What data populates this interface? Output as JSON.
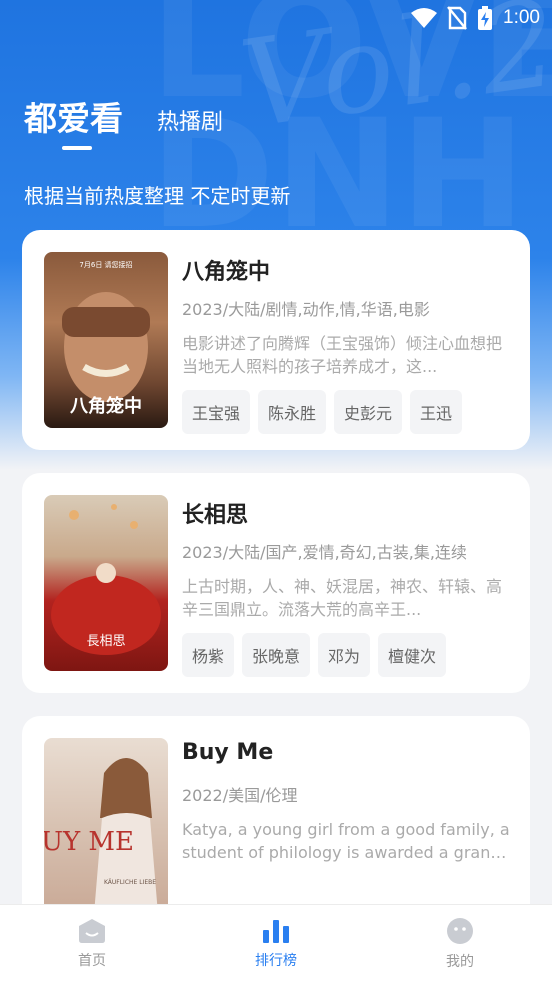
{
  "status": {
    "time": "1:00"
  },
  "header": {
    "tabs": [
      {
        "label": "都爱看"
      },
      {
        "label": "热播剧"
      }
    ],
    "subtitle": "根据当前热度整理 不定时更新"
  },
  "items": [
    {
      "title": "八角笼中",
      "meta": "2023/大陆/剧情,动作,情,华语,电影",
      "desc": "电影讲述了向腾辉（王宝强饰）倾注心血想把当地无人照料的孩子培养成才，这...",
      "tags": [
        "王宝强",
        "陈永胜",
        "史彭元",
        "王迅"
      ],
      "poster_text": "八角笼中",
      "poster_top_text": "7月6日 请您接招"
    },
    {
      "title": "长相思",
      "meta": "2023/大陆/国产,爱情,奇幻,古装,集,连续",
      "desc": "上古时期，人、神、妖混居，神农、轩辕、高辛三国鼎立。流落大荒的高辛王...",
      "tags": [
        "杨紫",
        "张晚意",
        "邓为",
        "檀健次"
      ],
      "poster_text": "長相思"
    },
    {
      "title": "Buy Me",
      "meta": "2022/美国/伦理",
      "desc": "Katya, a young girl from a good family, a student of philology is awarded a grant ...",
      "tags": [],
      "poster_text": "BUY ME",
      "poster_sub": "KÄUFLICHE LIEBE"
    }
  ],
  "nav": [
    {
      "label": "首页",
      "icon": "home-icon"
    },
    {
      "label": "排行榜",
      "icon": "ranking-icon",
      "active": true
    },
    {
      "label": "我的",
      "icon": "profile-icon"
    }
  ],
  "colors": {
    "accent": "#2a7ff0",
    "hero": "#1f74e0"
  }
}
